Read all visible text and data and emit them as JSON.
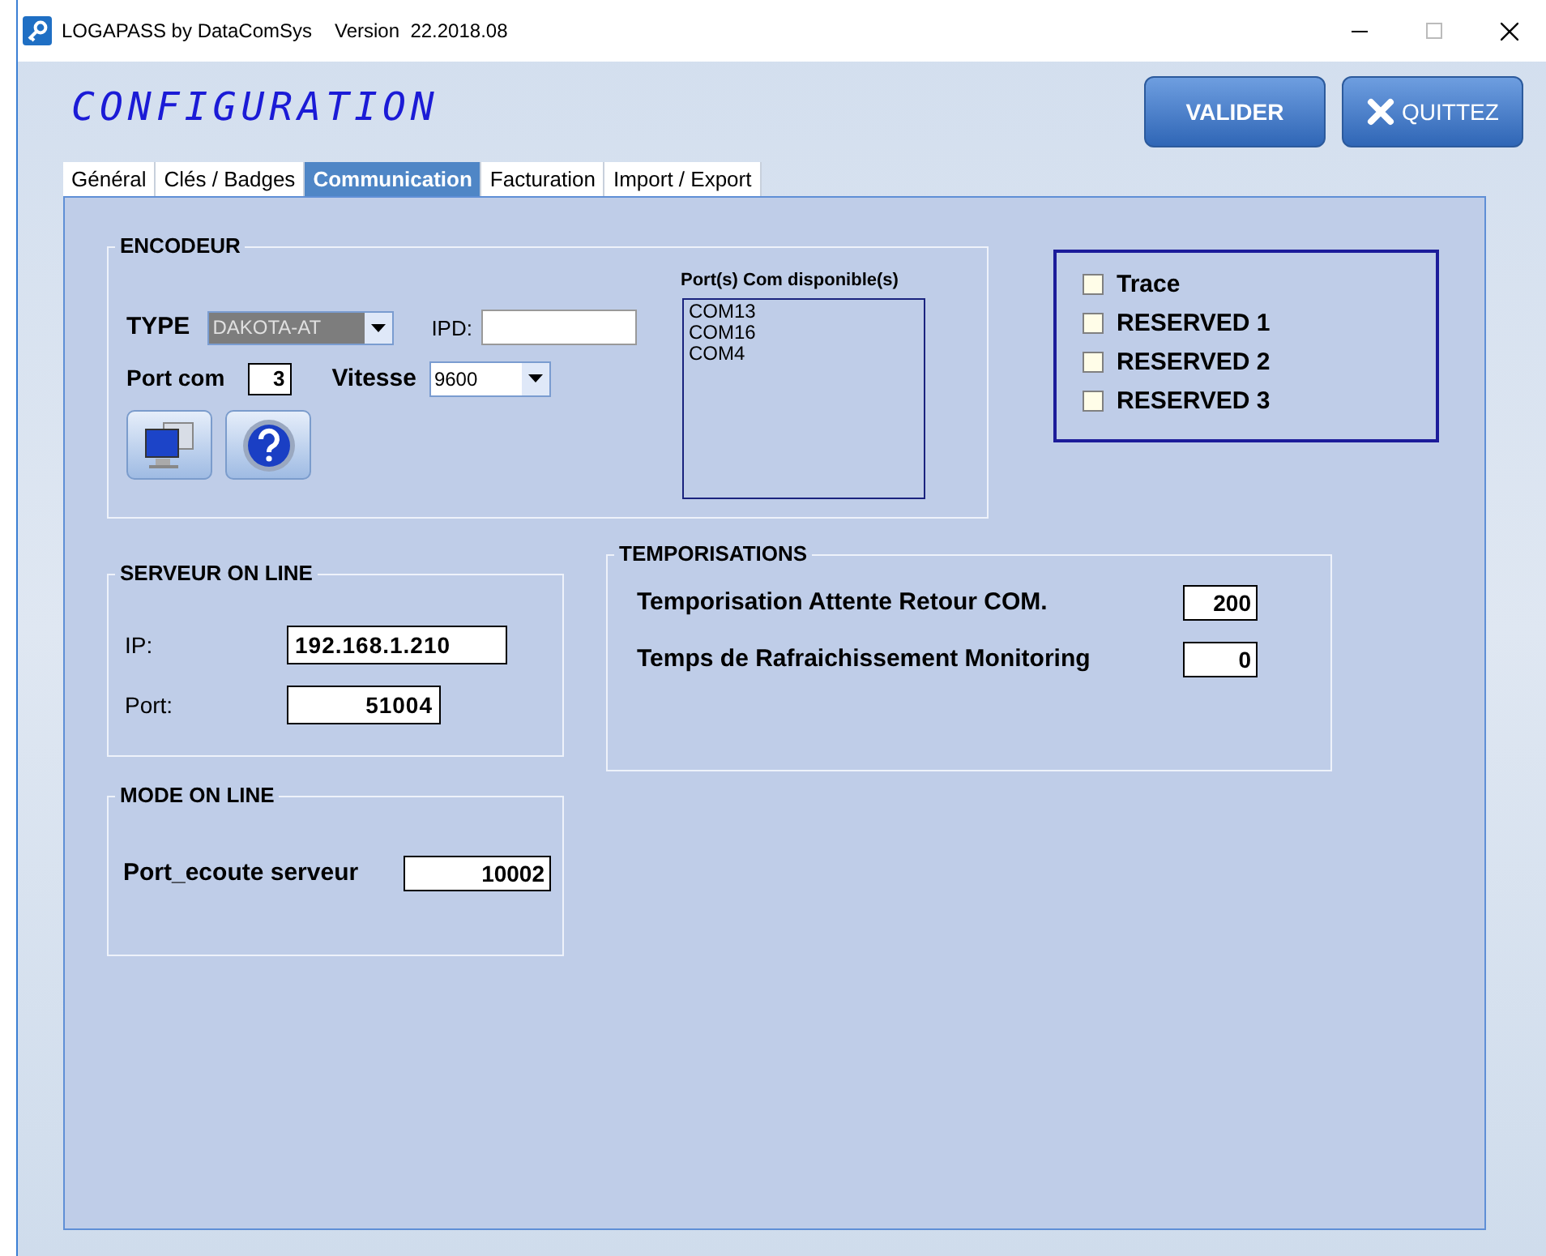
{
  "window": {
    "title": "LOGAPASS by DataComSys",
    "version": "Version  22.2018.08"
  },
  "header": {
    "title": "CONFIGURATION",
    "buttons": [
      {
        "label": "VALIDER",
        "kind": "plain"
      },
      {
        "label": "QUITTEZ",
        "kind": "close"
      }
    ]
  },
  "tabs": [
    {
      "label": "Général",
      "selected": false
    },
    {
      "label": "Clés / Badges",
      "selected": false
    },
    {
      "label": "Communication",
      "selected": true
    },
    {
      "label": "Facturation",
      "selected": false
    },
    {
      "label": "Import / Export",
      "selected": false
    }
  ],
  "encodeur": {
    "title": "ENCODEUR",
    "type_label": "TYPE",
    "type_value": "DAKOTA-AT",
    "type_disabled": true,
    "ipd_label": "IPD:",
    "port_label": "Port com",
    "port_value": "3",
    "speed_label": "Vitesse",
    "speed_value": "9600",
    "ports_label": "Port(s) Com disponible(s)",
    "ports": [
      "COM13",
      "COM16",
      "COM4"
    ]
  },
  "options": [
    {
      "label": "Trace",
      "checked": false
    },
    {
      "label": "RESERVED 1",
      "checked": false
    },
    {
      "label": "RESERVED 2",
      "checked": false
    },
    {
      "label": "RESERVED 3",
      "checked": false
    }
  ],
  "serveur": {
    "title": "SERVEUR ON LINE",
    "fields": [
      {
        "label": "IP:",
        "value": "192.168.1.210"
      },
      {
        "label": "Port:",
        "value": "51004"
      }
    ]
  },
  "temporisations": {
    "title": "TEMPORISATIONS",
    "fields": [
      {
        "label": "Temporisation Attente Retour COM.",
        "value": "200"
      },
      {
        "label": "Temps de Rafraichissement Monitoring",
        "value": "0"
      }
    ]
  },
  "mode": {
    "title": "MODE ON LINE",
    "fields": [
      {
        "label": "Port_ecoute serveur",
        "value": "10002"
      }
    ]
  }
}
